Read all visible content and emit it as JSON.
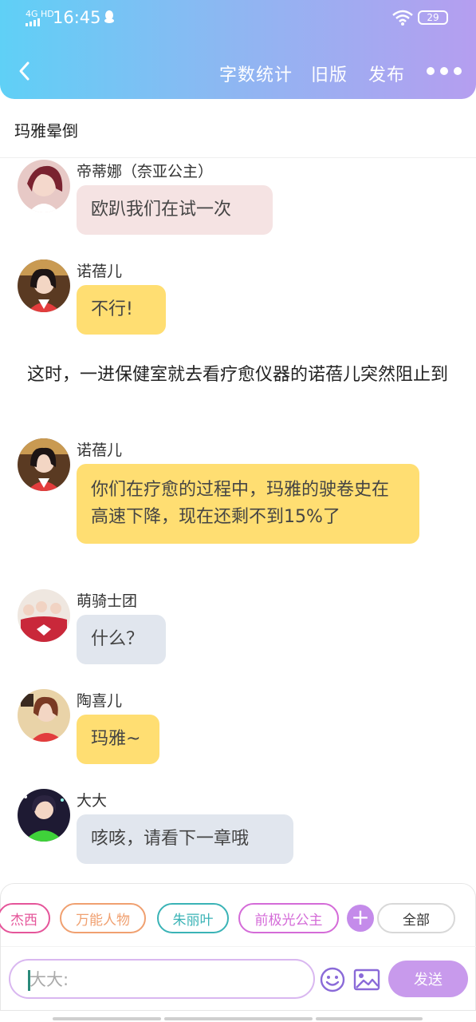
{
  "status_bar": {
    "network": "4G HD",
    "time": "16:45",
    "battery": "29"
  },
  "header": {
    "wordcount_label": "字数统计",
    "oldver_label": "旧版",
    "publish_label": "发布"
  },
  "chapter_title": "玛雅晕倒",
  "messages": [
    {
      "sender": "帝蒂娜（奈亚公主）",
      "text": "欧趴我们在试一次"
    },
    {
      "sender": "诺蓓儿",
      "text": "不行!"
    },
    {
      "sender": "诺蓓儿",
      "text": "你们在疗愈的过程中，玛雅的驶卷史在高速下降，现在还剩不到15%了"
    },
    {
      "sender": "萌骑士团",
      "text": "什么？"
    },
    {
      "sender": "陶喜儿",
      "text": "玛雅~"
    },
    {
      "sender": "大大",
      "text": "咳咳，请看下一章哦"
    }
  ],
  "narration": "这时，一进保健室就去看疗愈仪器的诺蓓儿突然阻止到",
  "characters": {
    "chips": [
      {
        "label": "杰西",
        "color": "#e5559a"
      },
      {
        "label": "万能人物",
        "color": "#f0a070"
      },
      {
        "label": "朱丽叶",
        "color": "#3ab3b6"
      },
      {
        "label": "前极光公主",
        "color": "#d46bd8"
      }
    ],
    "all_label": "全部"
  },
  "composer": {
    "placeholder": "大大:",
    "send_label": "发送"
  },
  "colors": {
    "header_gradient_start": "#5fd0f6",
    "header_gradient_end": "#b59ef0",
    "bubble_pink": "#f5e3e3",
    "bubble_yellow": "#ffde72",
    "bubble_gray": "#e1e6ee",
    "accent_purple": "#c89aec"
  }
}
